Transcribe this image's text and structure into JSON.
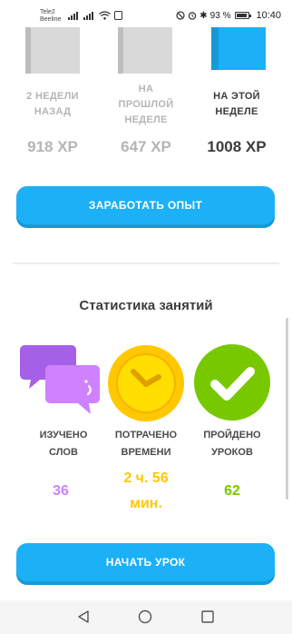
{
  "status_bar": {
    "carrier_1": "Tele2",
    "carrier_2": "Beeline",
    "battery_percent": "93 %",
    "time": "10:40"
  },
  "weekly": {
    "columns": [
      {
        "label_lines": [
          "2 НЕДЕЛИ",
          "НАЗАД"
        ],
        "xp": "918 XP"
      },
      {
        "label_lines": [
          "НА",
          "ПРОШЛОЙ",
          "НЕДЕЛЕ"
        ],
        "xp": "647 XP"
      },
      {
        "label_lines": [
          "НА ЭТОЙ",
          "НЕДЕЛЕ"
        ],
        "xp": "1008 XP"
      }
    ],
    "earn_button_label": "ЗАРАБОТАТЬ ОПЫТ"
  },
  "stats": {
    "title": "Статистика занятий",
    "items": [
      {
        "label_lines": [
          "ИЗУЧЕНО",
          "СЛОВ"
        ],
        "value_lines": [
          "36"
        ],
        "icon": "chat-bubbles-icon",
        "color": "#ce82ff"
      },
      {
        "label_lines": [
          "ПОТРАЧЕНО",
          "ВРЕМЕНИ"
        ],
        "value_lines": [
          "2 ч. 56",
          "мин."
        ],
        "icon": "clock-icon",
        "color": "#ffc800"
      },
      {
        "label_lines": [
          "ПРОЙДЕНО",
          "УРОКОВ"
        ],
        "value_lines": [
          "62"
        ],
        "icon": "checkmark-icon",
        "color": "#78c800"
      }
    ],
    "start_button_label": "НАЧАТЬ УРОК"
  },
  "colors": {
    "accent": "#1cb0f6",
    "inactive_text": "#b5b5b5",
    "active_text": "#3c3c3c"
  },
  "nav_bar": {
    "icons": [
      "back-triangle-icon",
      "home-circle-icon",
      "recents-square-icon"
    ]
  }
}
